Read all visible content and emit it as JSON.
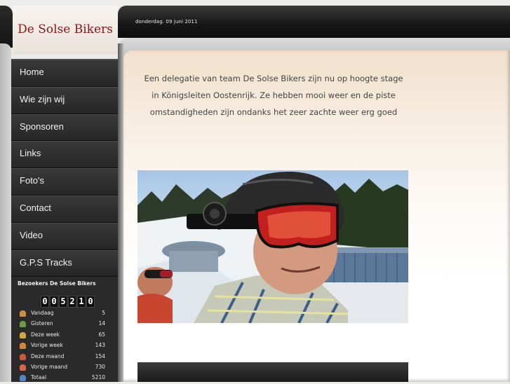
{
  "site": {
    "logo": "De Solse Bikers",
    "date": "donderdag. 09 juni 2011"
  },
  "nav": {
    "items": [
      {
        "label": "Home"
      },
      {
        "label": "Wie zijn wij"
      },
      {
        "label": "Sponsoren"
      },
      {
        "label": "Links"
      },
      {
        "label": "Foto's"
      },
      {
        "label": "Contact"
      },
      {
        "label": "Video"
      },
      {
        "label": "G.P.S Tracks"
      }
    ]
  },
  "visitors": {
    "title": "Bezoekers De Solse Bikers",
    "counter": [
      "0",
      "0",
      "5",
      "2",
      "1",
      "0"
    ],
    "rows": [
      {
        "label": "Vandaag",
        "value": "5",
        "icon_color": "#c98f4a"
      },
      {
        "label": "Gisteren",
        "value": "14",
        "icon_color": "#6f9a4c"
      },
      {
        "label": "Deze week",
        "value": "65",
        "icon_color": "#d1a64a"
      },
      {
        "label": "Vorige week",
        "value": "143",
        "icon_color": "#d4853a"
      },
      {
        "label": "Deze maand",
        "value": "154",
        "icon_color": "#c9593f"
      },
      {
        "label": "Vorige maand",
        "value": "730",
        "icon_color": "#d06a52"
      },
      {
        "label": "Totaal",
        "value": "5210",
        "icon_color": "#4f88c9"
      }
    ]
  },
  "content": {
    "intro_lines": [
      "Een delegatie van team De Solse Bikers zijn nu op  hoogte stage",
      "in Königsleiten Oostenrijk. Ze hebben mooi weer en de piste",
      "omstandigheden zijn ondanks het zeer zachte weer erg goed"
    ]
  }
}
